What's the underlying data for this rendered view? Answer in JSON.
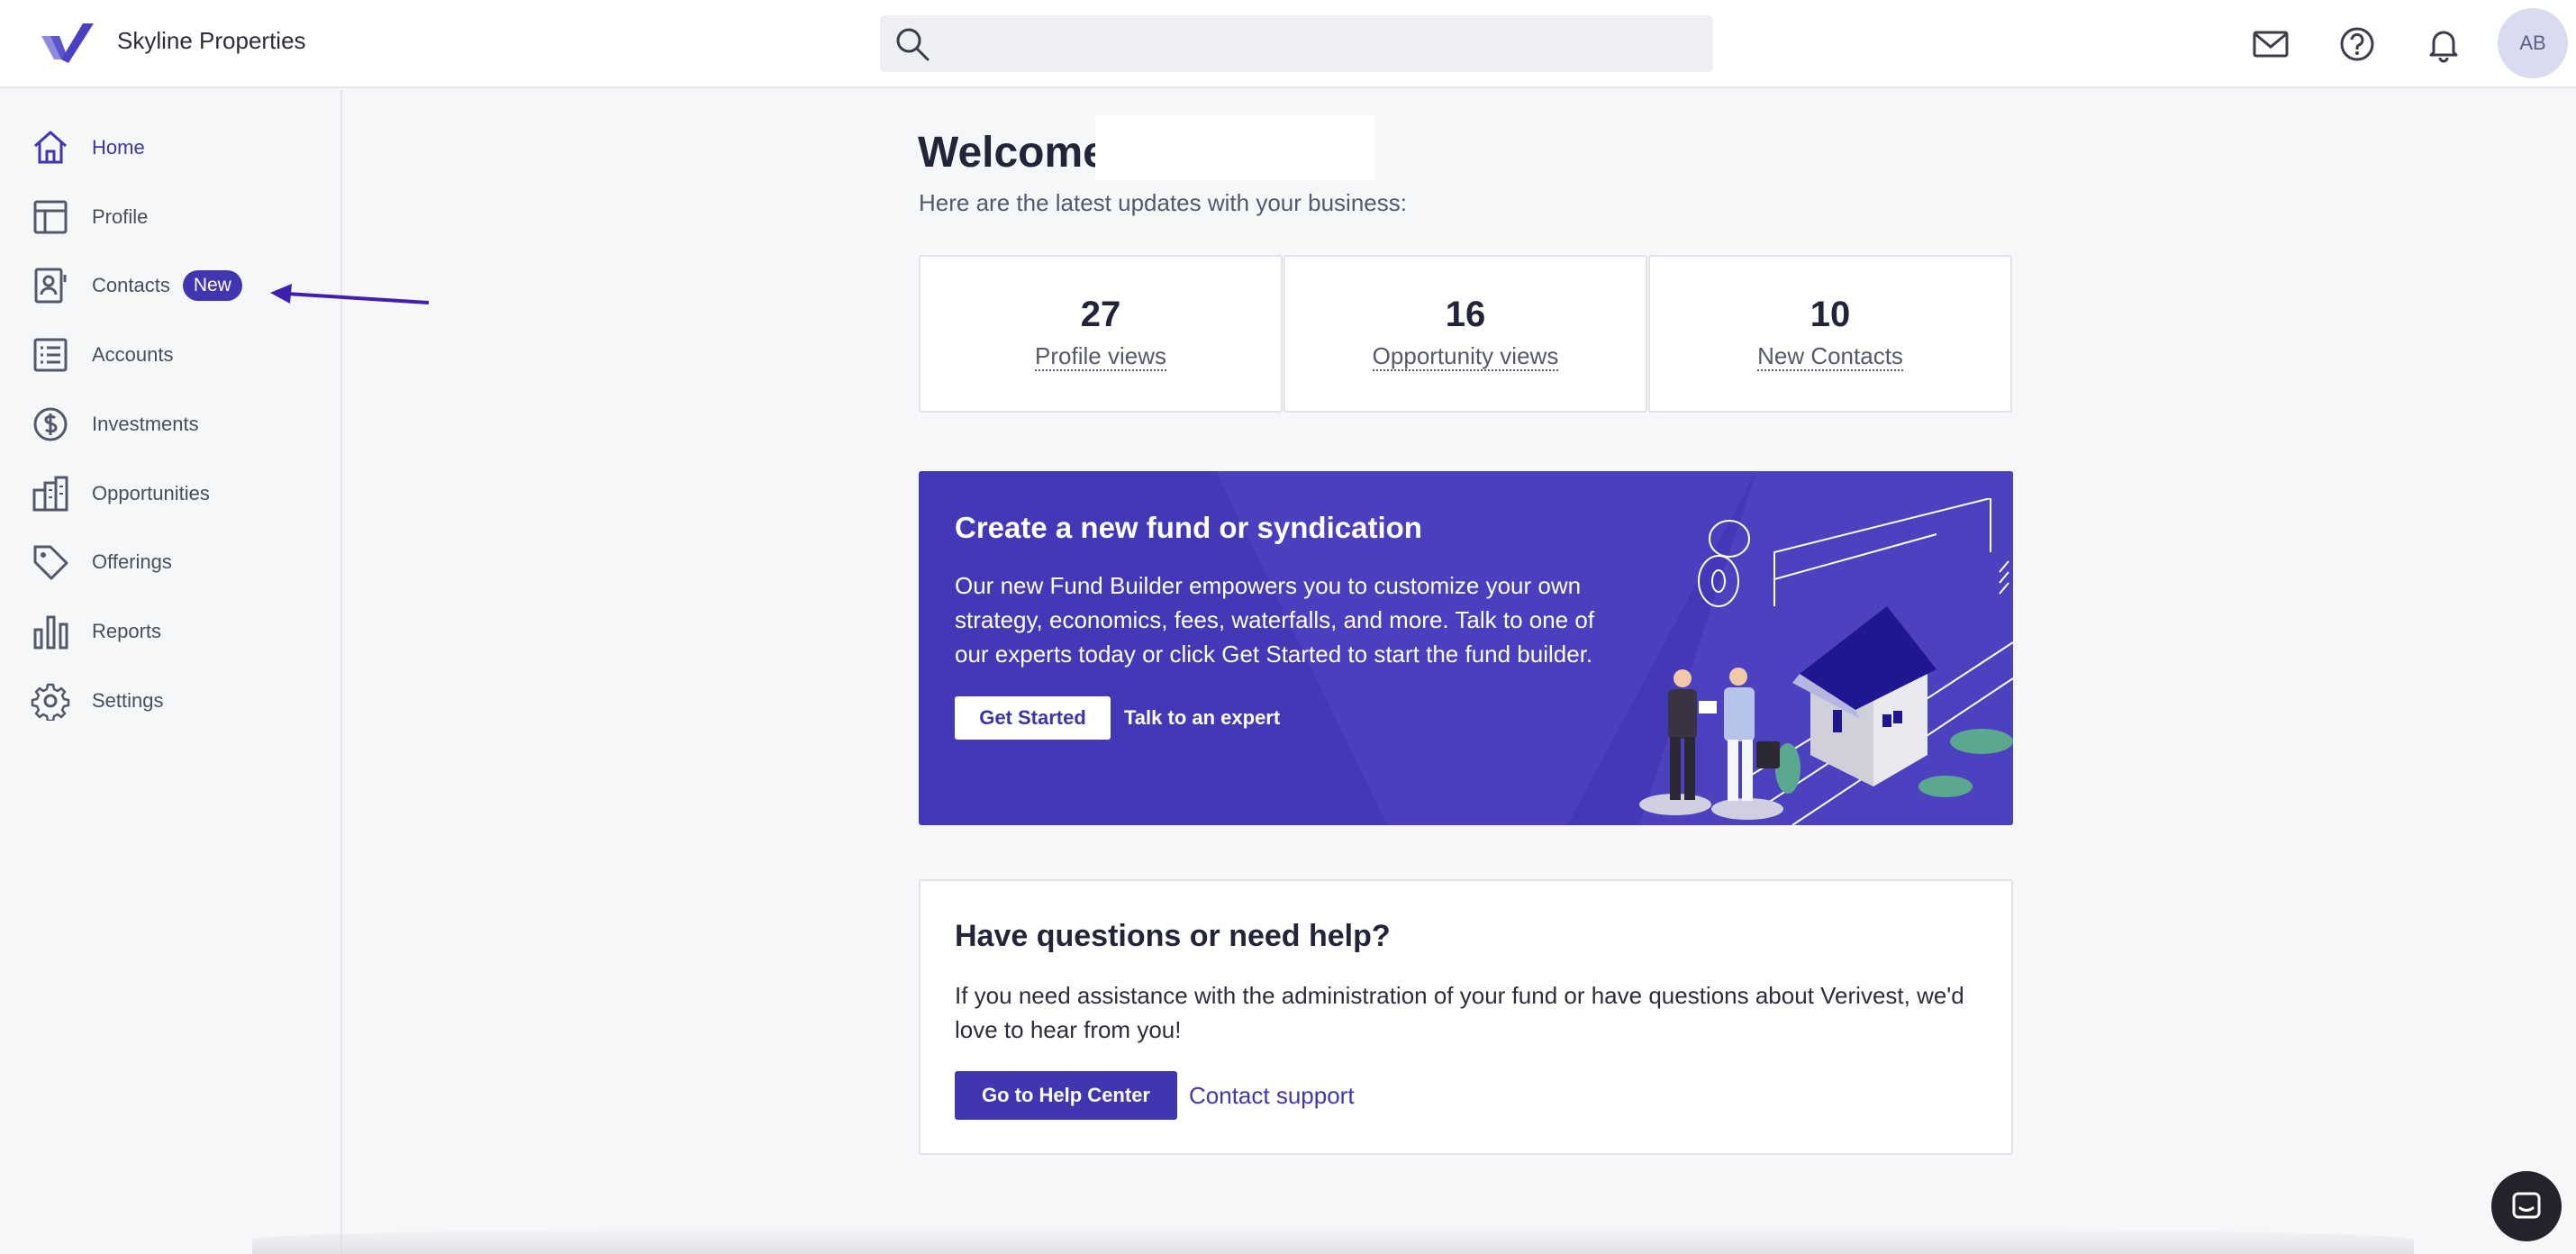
{
  "header": {
    "brand": "Skyline Properties",
    "search_placeholder": "",
    "avatar_initials": "AB",
    "icons": [
      "mail-icon",
      "help-icon",
      "bell-icon"
    ]
  },
  "sidebar": {
    "items": [
      {
        "label": "Home",
        "icon": "home-icon",
        "active": true
      },
      {
        "label": "Profile",
        "icon": "layout-icon"
      },
      {
        "label": "Contacts",
        "icon": "contacts-icon",
        "badge": "New"
      },
      {
        "label": "Accounts",
        "icon": "list-icon"
      },
      {
        "label": "Investments",
        "icon": "dollar-icon"
      },
      {
        "label": "Opportunities",
        "icon": "buildings-icon"
      },
      {
        "label": "Offerings",
        "icon": "tag-icon"
      },
      {
        "label": "Reports",
        "icon": "bar-chart-icon"
      },
      {
        "label": "Settings",
        "icon": "gear-icon"
      }
    ]
  },
  "main": {
    "welcome": "Welcome",
    "subtitle": "Here are the latest updates with your business:",
    "stats": [
      {
        "value": "27",
        "label": "Profile views"
      },
      {
        "value": "16",
        "label": "Opportunity views"
      },
      {
        "value": "10",
        "label": "New Contacts"
      }
    ],
    "banner": {
      "title": "Create a new fund or syndication",
      "text": "Our new Fund Builder empowers you to customize your own strategy, economics, fees, waterfalls, and more. Talk to one of our experts today or click Get Started to start the fund builder.",
      "primary_button": "Get Started",
      "secondary_link": "Talk to an expert"
    },
    "help": {
      "title": "Have questions or need help?",
      "text": "If you need assistance with the administration of your fund or have questions about Verivest, we'd love to hear from you!",
      "primary_button": "Go to Help Center",
      "secondary_link": "Contact support"
    }
  },
  "colors": {
    "accent": "#3f36b0",
    "banner": "#4338b5",
    "background": "#f6f7f9"
  }
}
